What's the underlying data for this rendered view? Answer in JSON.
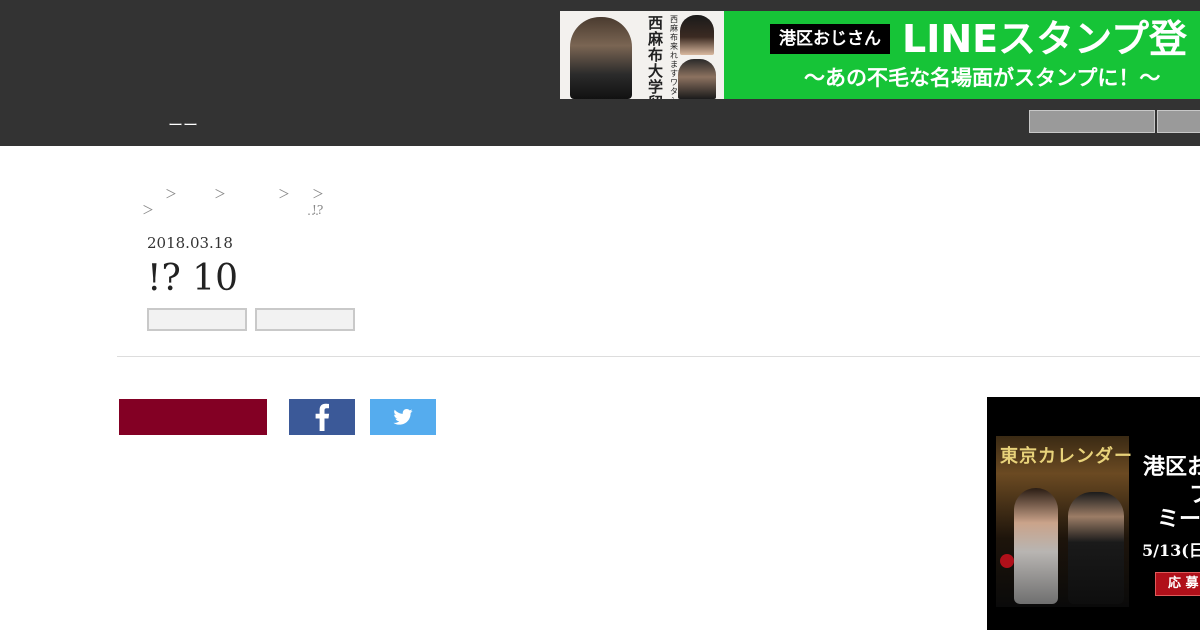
{
  "banner": {
    "tag": "港区おじさん",
    "title": "LINEスタンプ登",
    "subtitle": "〜あの不毛な名場面がスタンプに！〜",
    "photo_text": "西麻布大学留年中",
    "photo_small_text": "西麻布来れます？ワタシガ！"
  },
  "nav": {
    "item_label": "ーー"
  },
  "breadcrumb": {
    "line1": [
      "＞",
      "＞",
      "＞",
      "＞ !?"
    ],
    "line2": [
      "＞",
      "…"
    ]
  },
  "article": {
    "date": "2018.03.18",
    "title": "!? 10"
  },
  "ad": {
    "poster_title": "東京カレンダー",
    "headline1": "港区お",
    "headline2": "フ",
    "headline3": "ミーテ",
    "date": "5/13(日",
    "apply": "応 募"
  },
  "colors": {
    "header_bg": "#333333",
    "banner_green": "#16c437",
    "share_main": "#830024",
    "facebook": "#3b5998",
    "twitter": "#55acee"
  },
  "icons": {
    "facebook": "facebook-icon",
    "twitter": "twitter-icon"
  }
}
